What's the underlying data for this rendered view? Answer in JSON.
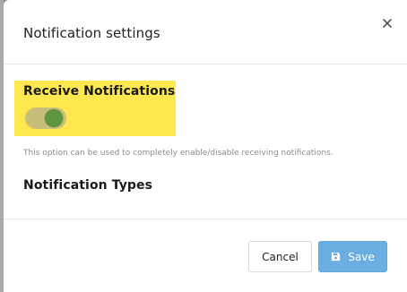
{
  "modal": {
    "title": "Notification settings",
    "close_icon": "close-icon"
  },
  "receive": {
    "label": "Receive Notifications",
    "toggle_state": "on",
    "help_text": "This option can be used to completely enable/disable receiving notifications."
  },
  "types": {
    "label": "Notification Types"
  },
  "footer": {
    "cancel_label": "Cancel",
    "save_label": "Save",
    "save_icon": "save-icon"
  },
  "colors": {
    "highlight": "#fde84f",
    "toggle_knob": "#5f9440",
    "save_button": "#6aaee2"
  }
}
